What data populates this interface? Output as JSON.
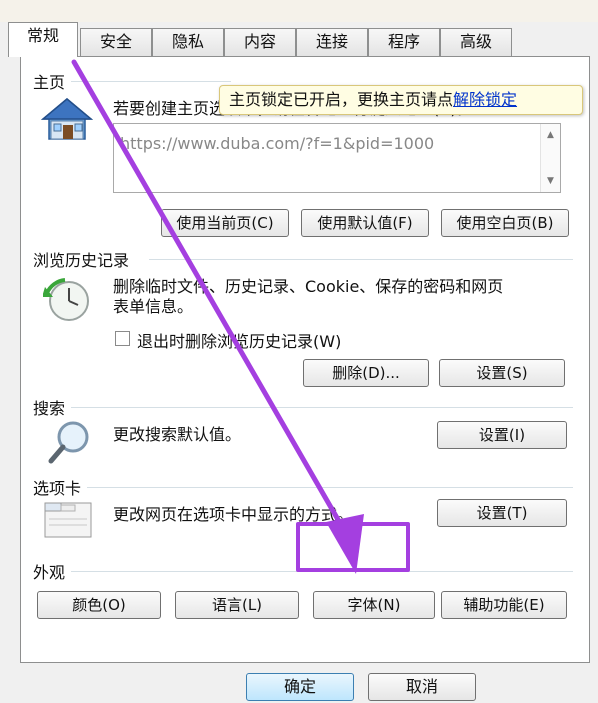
{
  "tabs": [
    "常规",
    "安全",
    "隐私",
    "内容",
    "连接",
    "程序",
    "高级"
  ],
  "homepage": {
    "title": "主页",
    "desc": "若要创建主页选项卡，请在各地址行键入地址(R)。",
    "url": "https://www.duba.com/?f=1&pid=1000",
    "tooltip_text": "主页锁定已开启，更换主页请点",
    "tooltip_link": "解除锁定",
    "buttons": {
      "use_current": "使用当前页(C)",
      "use_default": "使用默认值(F)",
      "use_blank": "使用空白页(B)"
    }
  },
  "history": {
    "title": "浏览历史记录",
    "desc_line1": "删除临时文件、历史记录、Cookie、保存的密码和网页",
    "desc_line2": "表单信息。",
    "checkbox_label": "退出时删除浏览历史记录(W)",
    "delete_btn": "删除(D)...",
    "settings_btn": "设置(S)"
  },
  "search": {
    "title": "搜索",
    "desc": "更改搜索默认值。",
    "settings_btn": "设置(I)"
  },
  "tabs_section": {
    "title": "选项卡",
    "desc": "更改网页在选项卡中显示的方式。",
    "settings_btn": "设置(T)"
  },
  "appearance": {
    "title": "外观",
    "colors_btn": "颜色(O)",
    "languages_btn": "语言(L)",
    "fonts_btn": "字体(N)",
    "accessibility_btn": "辅助功能(E)"
  },
  "footer": {
    "ok_btn": "确定",
    "cancel_btn": "取消"
  },
  "colors": {
    "annotation": "#a43fe0",
    "link": "#0033cc"
  }
}
